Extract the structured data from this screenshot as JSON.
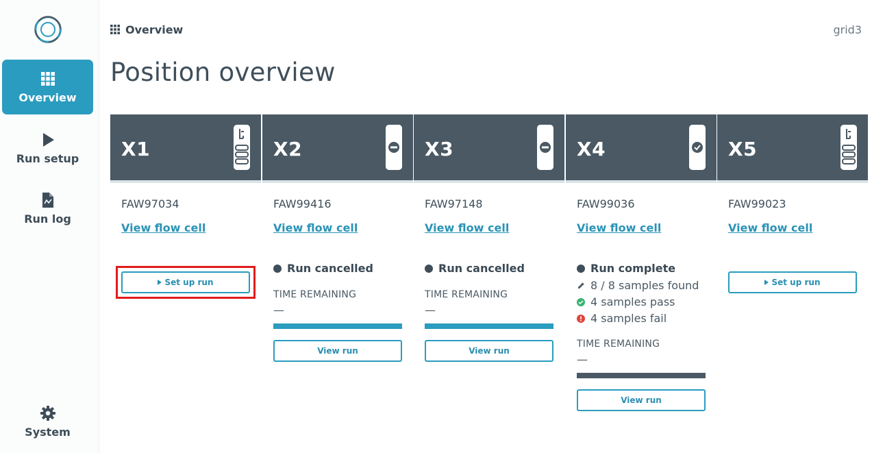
{
  "app": {
    "hostname": "grid3"
  },
  "sidebar": {
    "items": [
      {
        "label": "Overview",
        "active": true
      },
      {
        "label": "Run setup",
        "active": false
      },
      {
        "label": "Run log",
        "active": false
      },
      {
        "label": "System",
        "active": false
      }
    ]
  },
  "breadcrumb": {
    "label": "Overview"
  },
  "page": {
    "title": "Position overview"
  },
  "colors": {
    "accent": "#2a9cbf",
    "header_bg": "#4a5964",
    "progress_cancelled": "#2a9cbf",
    "progress_complete": "#4a5964",
    "pass": "#3bb273",
    "fail": "#e0453a",
    "highlight": "#e31b1b"
  },
  "positions": [
    {
      "label": "X1",
      "serial": "FAW97034",
      "link": "View flow cell",
      "icon": "flow-cell-loaded-icon",
      "button": "Set up run",
      "highlighted": true
    },
    {
      "label": "X2",
      "serial": "FAW99416",
      "link": "View flow cell",
      "icon": "flow-cell-cancelled-icon",
      "status": "Run cancelled",
      "time_label": "TIME REMAINING",
      "time_value": "—",
      "progress": 1.0,
      "button": "View run"
    },
    {
      "label": "X3",
      "serial": "FAW97148",
      "link": "View flow cell",
      "icon": "flow-cell-cancelled-icon",
      "status": "Run cancelled",
      "time_label": "TIME REMAINING",
      "time_value": "—",
      "progress": 1.0,
      "button": "View run"
    },
    {
      "label": "X4",
      "serial": "FAW99036",
      "link": "View flow cell",
      "icon": "flow-cell-complete-icon",
      "status": "Run complete",
      "details": [
        "8 / 8 samples found",
        "4 samples pass",
        "4 samples fail"
      ],
      "time_label": "TIME REMAINING",
      "time_value": "—",
      "progress": 1.0,
      "button": "View run"
    },
    {
      "label": "X5",
      "serial": "FAW99023",
      "link": "View flow cell",
      "icon": "flow-cell-loaded-icon",
      "button": "Set up run"
    }
  ]
}
